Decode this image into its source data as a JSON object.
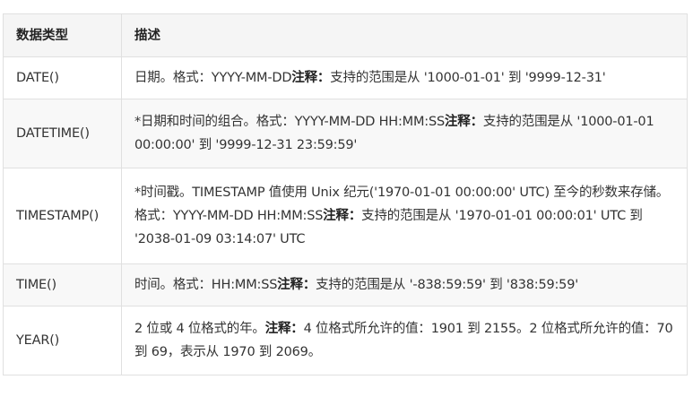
{
  "table": {
    "headers": {
      "type": "数据类型",
      "desc": "描述"
    },
    "rows": [
      {
        "type": "DATE()",
        "desc_pre": "日期。格式：YYYY-MM-DD",
        "note": "注释：",
        "desc_post": "支持的范围是从 '1000-01-01' 到 '9999-12-31'"
      },
      {
        "type": "DATETIME()",
        "desc_pre": "*日期和时间的组合。格式：YYYY-MM-DD HH:MM:SS",
        "note": "注释：",
        "desc_post": "支持的范围是从 '1000-01-01 00:00:00' 到 '9999-12-31 23:59:59'"
      },
      {
        "type": "TIMESTAMP()",
        "desc_pre": "*时间戳。TIMESTAMP 值使用 Unix 纪元('1970-01-01 00:00:00' UTC) 至今的秒数来存储。格式：YYYY-MM-DD HH:MM:SS",
        "note": "注释：",
        "desc_post": "支持的范围是从 '1970-01-01 00:00:01' UTC 到 '2038-01-09 03:14:07' UTC"
      },
      {
        "type": "TIME()",
        "desc_pre": "时间。格式：HH:MM:SS",
        "note": "注释：",
        "desc_post": "支持的范围是从 '-838:59:59' 到 '838:59:59'"
      },
      {
        "type": "YEAR()",
        "desc_pre": "2 位或 4 位格式的年。",
        "note": "注释：",
        "desc_post": "4 位格式所允许的值：1901 到 2155。2 位格式所允许的值：70 到 69，表示从 1970 到 2069。"
      }
    ]
  }
}
